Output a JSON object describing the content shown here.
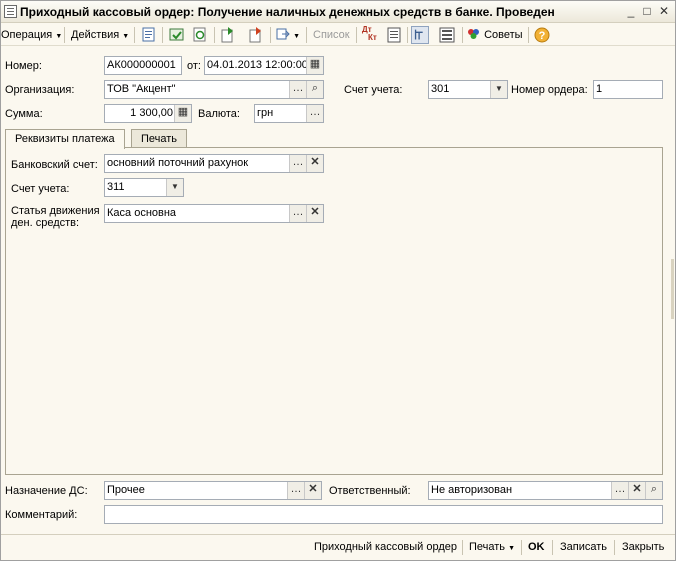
{
  "window": {
    "title": "Приходный кассовый ордер: Получение наличных денежных средств в банке. Проведен"
  },
  "toolbar": {
    "operation": "Операция",
    "actions": "Действия",
    "list": "Список",
    "tips": "Советы",
    "dt_kt_top": "Дт",
    "dt_kt_bottom": "Кт"
  },
  "header": {
    "number_label": "Номер:",
    "number_value": "АК000000001",
    "date_label": "от:",
    "date_value": "04.01.2013 12:00:00",
    "org_label": "Организация:",
    "org_value": "ТОВ \"Акцент\"",
    "account_label": "Счет учета:",
    "account_value": "301",
    "order_no_label": "Номер ордера:",
    "order_no_value": "1",
    "sum_label": "Сумма:",
    "sum_value": "1 300,00",
    "currency_label": "Валюта:",
    "currency_value": "грн"
  },
  "tabs": [
    {
      "label": "Реквизиты платежа",
      "active": true
    },
    {
      "label": "Печать",
      "active": false
    }
  ],
  "payment": {
    "bank_account_label": "Банковский счет:",
    "bank_account_value": "основний поточний рахунок",
    "account_label": "Счет учета:",
    "account_value": "311",
    "cashflow_label_line1": "Статья движения",
    "cashflow_label_line2": "ден. средств:",
    "cashflow_value": "Каса основна"
  },
  "footer": {
    "purpose_label": "Назначение ДС:",
    "purpose_value": "Прочее",
    "responsible_label": "Ответственный:",
    "responsible_value": "Не авторизован",
    "comment_label": "Комментарий:",
    "comment_value": ""
  },
  "bottombar": {
    "print_form": "Приходный кассовый ордер",
    "print": "Печать",
    "ok": "OK",
    "save": "Записать",
    "close": "Закрыть"
  }
}
